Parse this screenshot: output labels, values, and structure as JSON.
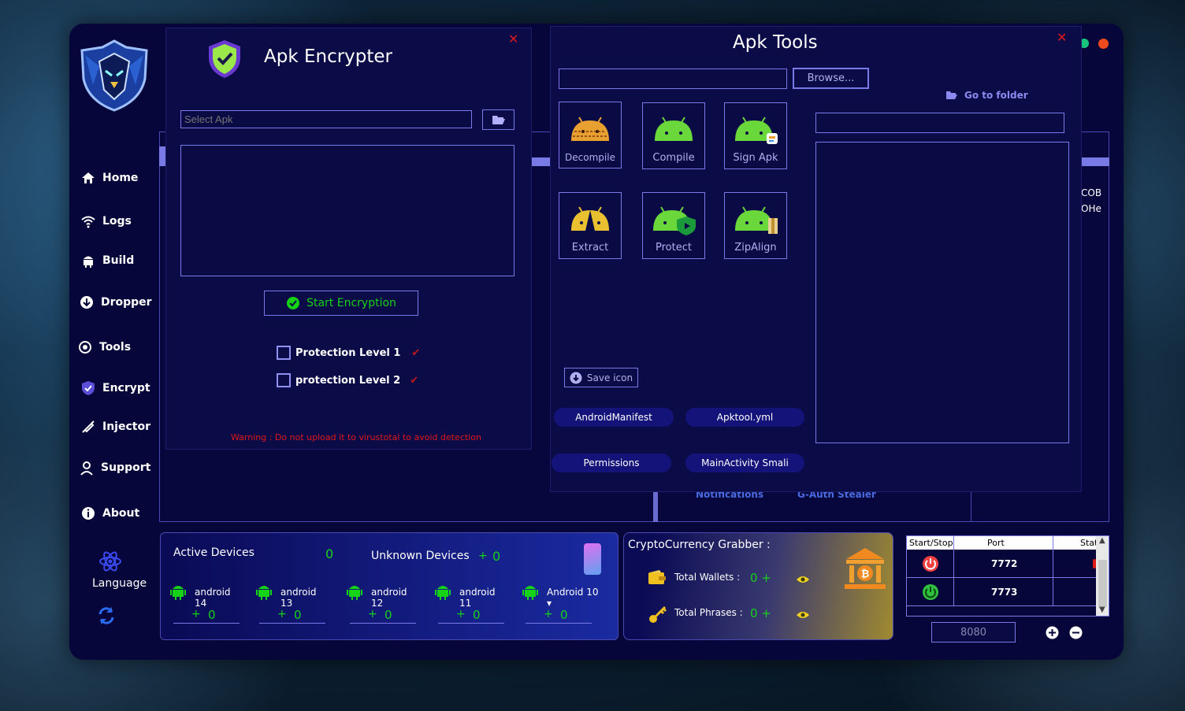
{
  "sidebar": {
    "items": [
      {
        "label": "Home",
        "icon": "home-icon"
      },
      {
        "label": "Logs",
        "icon": "wifi-icon"
      },
      {
        "label": "Build",
        "icon": "android-icon"
      },
      {
        "label": "Dropper",
        "icon": "download-icon"
      },
      {
        "label": "Tools",
        "icon": "tools-icon"
      },
      {
        "label": "Encrypt",
        "icon": "shield-icon"
      },
      {
        "label": "Injector",
        "icon": "syringe-icon"
      },
      {
        "label": "Support",
        "icon": "support-icon"
      },
      {
        "label": "About",
        "icon": "info-icon"
      }
    ],
    "language_label": "Language"
  },
  "encrypter": {
    "title": "Apk Encrypter",
    "select_placeholder": "Select Apk",
    "start_button": "Start Encryption",
    "level1": "Protection Level 1",
    "level2": "protection Level 2",
    "warning": "Warning : Do not upload it to virustotal to avoid detection"
  },
  "tools": {
    "title": "Apk Tools",
    "browse": "Browse...",
    "go_folder": "Go to folder",
    "tiles": [
      "Decompile",
      "Compile",
      "Sign Apk",
      "Extract",
      "Protect",
      "ZipAlign"
    ],
    "save_icon": "Save icon",
    "pills": [
      "AndroidManifest",
      "Apktool.yml",
      "Permissions",
      "MainActivity Smali"
    ]
  },
  "background_labels": {
    "notifications": "Notifications",
    "gauth": "G-Auth Stealer",
    "partial1": "COB",
    "partial2": "OHe"
  },
  "devices": {
    "active_label": "Active Devices",
    "active_count": "0",
    "unknown_label": "Unknown Devices",
    "unknown_plus": "+",
    "unknown_count": "0",
    "versions": [
      {
        "label": "android 14",
        "plus": "+",
        "count": "0"
      },
      {
        "label": "android 13",
        "plus": "+",
        "count": "0"
      },
      {
        "label": "android 12",
        "plus": "+",
        "count": "0"
      },
      {
        "label": "android 11",
        "plus": "+",
        "count": "0"
      },
      {
        "label": "Android 10 ▾",
        "plus": "+",
        "count": "0"
      }
    ]
  },
  "crypto": {
    "title": "CryptoCurrency Grabber :",
    "wallets_label": "Total Wallets :",
    "wallets_value": "0 +",
    "phrases_label": "Total Phrases :",
    "phrases_value": "0 +"
  },
  "ports": {
    "headers": [
      "Start/Stop",
      "Port",
      "Stat"
    ],
    "rows": [
      {
        "port": "7772",
        "state": "stop"
      },
      {
        "port": "7773",
        "state": "start"
      }
    ],
    "port_input": "8080"
  },
  "colors": {
    "accent": "#7a7ae6",
    "green": "#17d317",
    "red": "#e01818"
  }
}
